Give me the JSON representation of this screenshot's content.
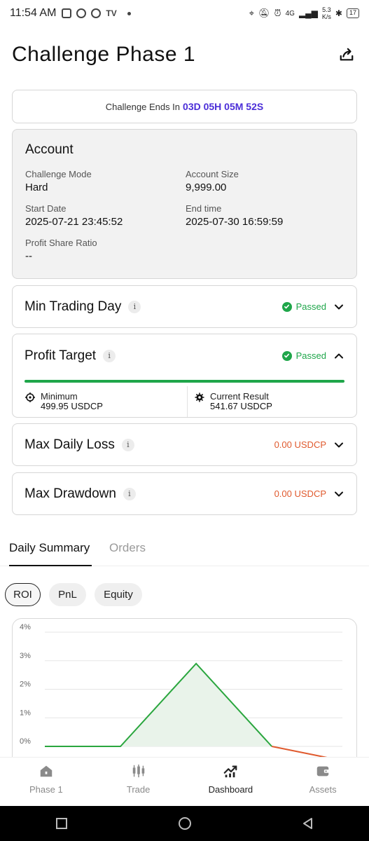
{
  "status_bar": {
    "time": "11:54 AM",
    "network": "4G",
    "speed_value": "5.3",
    "speed_unit": "K/s",
    "battery": "17"
  },
  "header": {
    "title": "Challenge Phase 1"
  },
  "countdown": {
    "label": "Challenge Ends In",
    "value": "03D 05H 05M 52S"
  },
  "account": {
    "title": "Account",
    "fields": [
      {
        "label": "Challenge Mode",
        "value": "Hard"
      },
      {
        "label": "Account Size",
        "value": "9,999.00"
      },
      {
        "label": "Start Date",
        "value": "2025-07-21 23:45:52"
      },
      {
        "label": "End time",
        "value": "2025-07-30 16:59:59"
      },
      {
        "label": "Profit Share Ratio",
        "value": "--"
      }
    ]
  },
  "rules": {
    "min_trading_day": {
      "title": "Min Trading Day",
      "info": "i",
      "status": "Passed"
    },
    "profit_target": {
      "title": "Profit Target",
      "info": "i",
      "status": "Passed",
      "progress": 1.0,
      "minimum_label": "Minimum",
      "minimum_value": "499.95 USDCP",
      "current_label": "Current Result",
      "current_value": "541.67 USDCP"
    },
    "max_daily_loss": {
      "title": "Max Daily Loss",
      "info": "i",
      "value": "0.00 USDCP"
    },
    "max_drawdown": {
      "title": "Max Drawdown",
      "info": "i",
      "value": "0.00 USDCP"
    }
  },
  "tabs": [
    {
      "label": "Daily Summary",
      "active": true
    },
    {
      "label": "Orders",
      "active": false
    }
  ],
  "chips": [
    {
      "label": "ROI",
      "selected": true
    },
    {
      "label": "PnL",
      "selected": false
    },
    {
      "label": "Equity",
      "selected": false
    }
  ],
  "chart_data": {
    "type": "line",
    "y_ticks": [
      "4%",
      "3%",
      "2%",
      "1%",
      "0%"
    ],
    "ylim": [
      0,
      4
    ],
    "xlim": [
      0,
      5.9
    ],
    "x": [
      0,
      1.5,
      3.0,
      4.5,
      5.9
    ],
    "y": [
      0.0,
      0.0,
      2.9,
      0.0,
      -0.5
    ],
    "colors": {
      "positive": "#2aa63e",
      "negative": "#e05a2e",
      "fill": "#e9f3ea"
    }
  },
  "bottom_nav": [
    {
      "label": "Phase 1",
      "icon": "home-icon",
      "active": false
    },
    {
      "label": "Trade",
      "icon": "candlestick-icon",
      "active": false
    },
    {
      "label": "Dashboard",
      "icon": "dashboard-chart-icon",
      "active": true
    },
    {
      "label": "Assets",
      "icon": "wallet-icon",
      "active": false
    }
  ]
}
